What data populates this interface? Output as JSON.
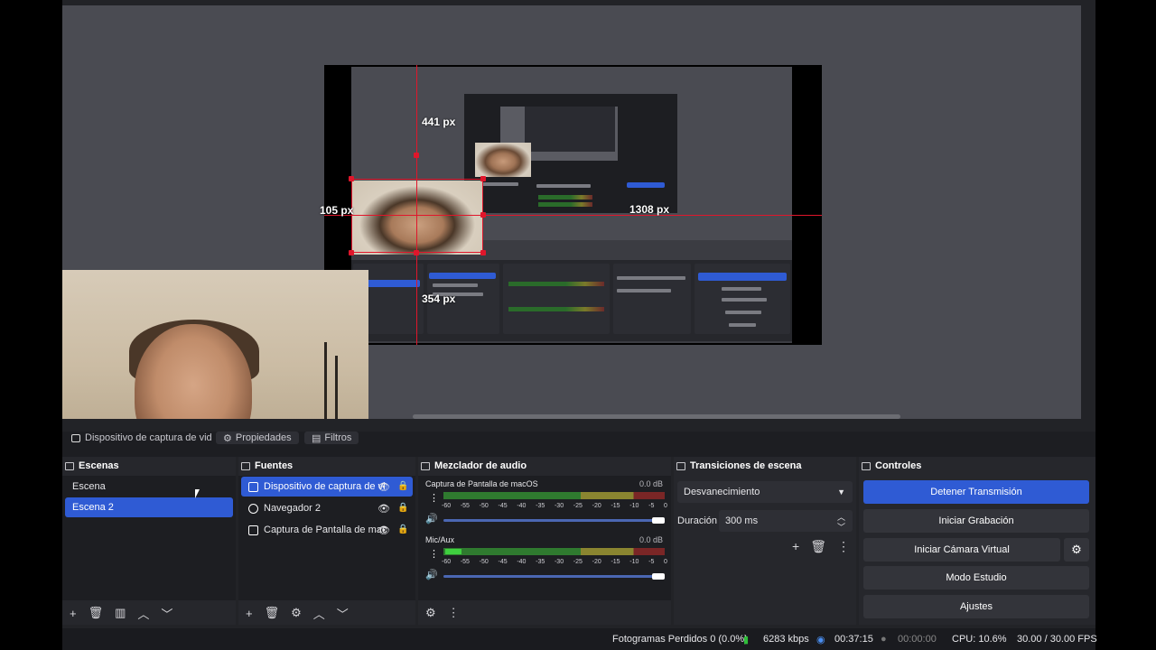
{
  "preview": {
    "measure_top": "441 px",
    "measure_left": "105 px",
    "measure_right": "1308 px",
    "measure_bottom": "354 px"
  },
  "context_bar": {
    "source_name": "Dispositivo de captura de vid",
    "properties_label": "Propiedades",
    "filters_label": "Filtros"
  },
  "scenes": {
    "title": "Escenas",
    "items": [
      {
        "label": "Escena",
        "selected": false
      },
      {
        "label": "Escena 2",
        "selected": true
      }
    ]
  },
  "sources": {
    "title": "Fuentes",
    "items": [
      {
        "label": "Dispositivo de captura de vi",
        "icon": "camera-icon",
        "selected": true
      },
      {
        "label": "Navegador 2",
        "icon": "globe-icon",
        "selected": false
      },
      {
        "label": "Captura de Pantalla de mac",
        "icon": "monitor-icon",
        "selected": false
      }
    ]
  },
  "mixer": {
    "title": "Mezclador de audio",
    "channels": [
      {
        "name": "Captura de Pantalla de macOS",
        "db": "0.0 dB",
        "volume": 1.0
      },
      {
        "name": "Mic/Aux",
        "db": "0.0 dB",
        "volume": 1.0
      }
    ],
    "ticks": [
      "-60",
      "-55",
      "-50",
      "-45",
      "-40",
      "-35",
      "-30",
      "-25",
      "-20",
      "-15",
      "-10",
      "-5",
      "0"
    ]
  },
  "transitions": {
    "title": "Transiciones de escena",
    "selected": "Desvanecimiento",
    "duration_label": "Duración",
    "duration_value": "300 ms"
  },
  "controls": {
    "title": "Controles",
    "buttons": {
      "stop_stream": "Detener Transmisión",
      "start_recording": "Iniciar Grabación",
      "start_virtual_cam": "Iniciar Cámara Virtual",
      "studio_mode": "Modo Estudio",
      "settings": "Ajustes"
    }
  },
  "statusbar": {
    "dropped_frames": "Fotogramas Perdidos 0 (0.0%)",
    "bitrate": "6283 kbps",
    "stream_time": "00:37:15",
    "record_time": "00:00:00",
    "cpu": "CPU: 10.6%",
    "fps": "30.00 / 30.00 FPS"
  },
  "colors": {
    "accent": "#2f5bd4",
    "guide": "#e0162b",
    "live": "#2fbf3a"
  }
}
